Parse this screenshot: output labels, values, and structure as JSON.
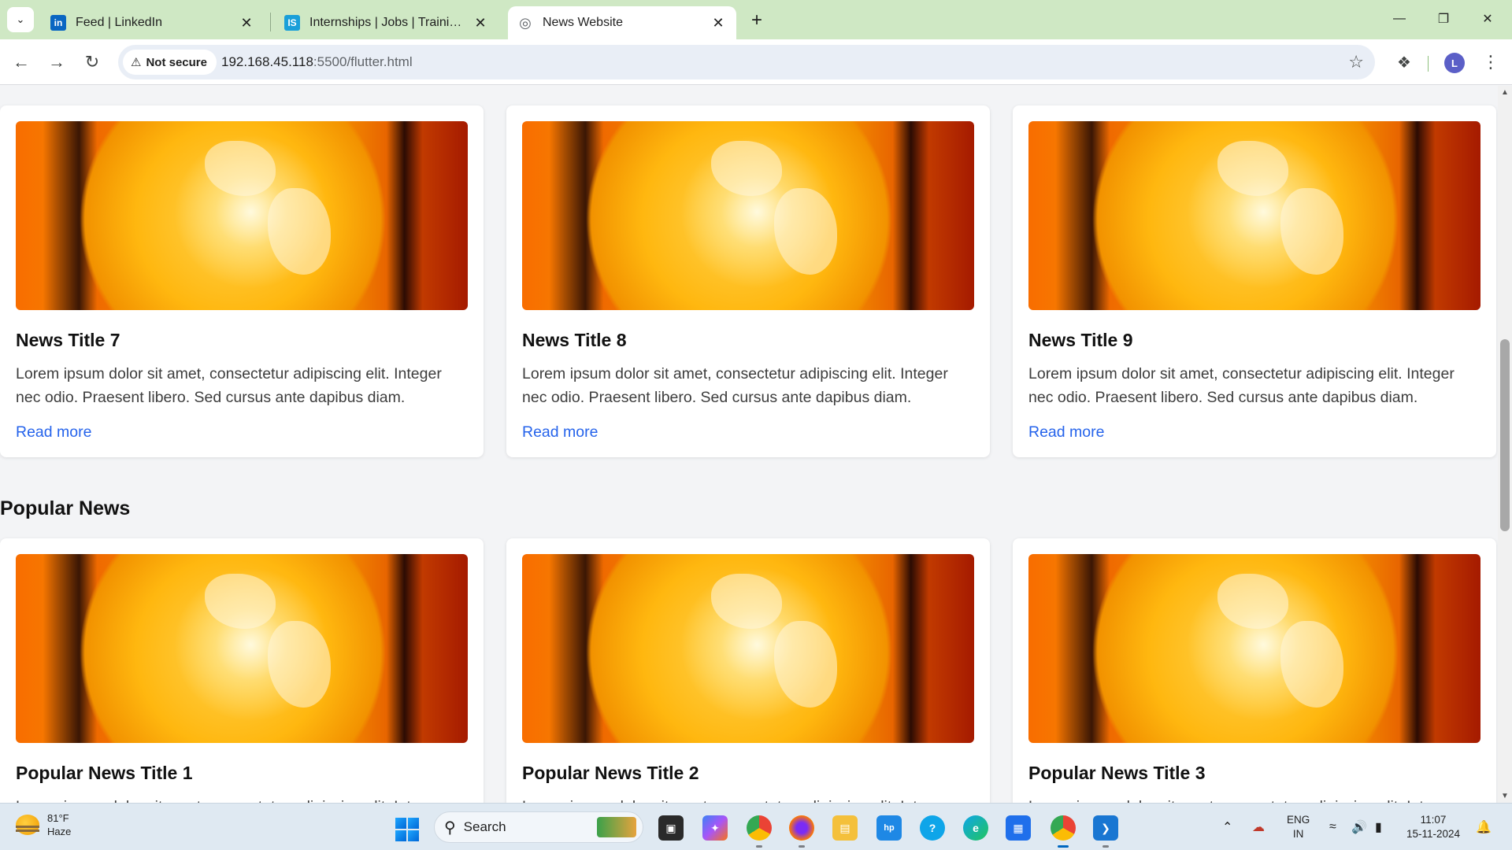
{
  "browser": {
    "tabs": [
      {
        "title": "Feed | LinkedIn",
        "favicon_text": "in",
        "favicon_color": "#0a66c2",
        "active": false
      },
      {
        "title": "Internships | Jobs | Trainings & Online Courses",
        "favicon_text": "IS",
        "favicon_color": "#1a9fd9",
        "active": false
      },
      {
        "title": "News Website",
        "favicon_text": "◎",
        "favicon_color": "#5f6368",
        "active": true
      }
    ],
    "security_label": "Not secure",
    "url_host": "192.168.45.118",
    "url_rest": ":5500/flutter.html",
    "profile_initial": "L"
  },
  "page": {
    "latest_cards": [
      {
        "title": "News Title 7",
        "text": "Lorem ipsum dolor sit amet, consectetur adipiscing elit. Integer nec odio. Praesent libero. Sed cursus ante dapibus diam.",
        "link": "Read more"
      },
      {
        "title": "News Title 8",
        "text": "Lorem ipsum dolor sit amet, consectetur adipiscing elit. Integer nec odio. Praesent libero. Sed cursus ante dapibus diam.",
        "link": "Read more"
      },
      {
        "title": "News Title 9",
        "text": "Lorem ipsum dolor sit amet, consectetur adipiscing elit. Integer nec odio. Praesent libero. Sed cursus ante dapibus diam.",
        "link": "Read more"
      }
    ],
    "popular_heading": "Popular News",
    "popular_cards": [
      {
        "title": "Popular News Title 1",
        "text": "Lorem ipsum dolor sit amet, consectetur adipiscing elit. Integer"
      },
      {
        "title": "Popular News Title 2",
        "text": "Lorem ipsum dolor sit amet, consectetur adipiscing elit. Integer"
      },
      {
        "title": "Popular News Title 3",
        "text": "Lorem ipsum dolor sit amet, consectetur adipiscing elit. Integer"
      }
    ],
    "link_color": "#2563eb"
  },
  "taskbar": {
    "weather_temp": "81°F",
    "weather_desc": "Haze",
    "search_label": "Search",
    "language_top": "ENG",
    "language_bottom": "IN",
    "time": "11:07",
    "date": "15-11-2024",
    "apps": [
      "file-explorer-icon",
      "copilot-icon",
      "chrome-icon",
      "firefox-icon",
      "folder-icon",
      "myhp-icon",
      "skype-icon",
      "edge-icon",
      "store-icon",
      "chrome-active-icon",
      "vscode-icon"
    ]
  }
}
